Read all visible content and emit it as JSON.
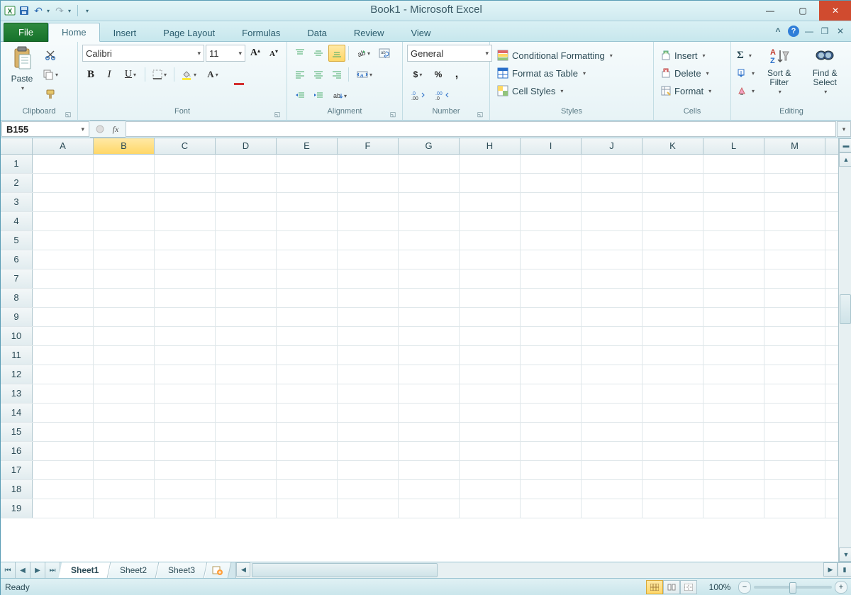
{
  "title": "Book1 - Microsoft Excel",
  "qat": {
    "undo": "↶",
    "redo": "↷"
  },
  "window_controls": {
    "min": "—",
    "max": "▢",
    "close": "✕"
  },
  "tabs": {
    "file": "File",
    "items": [
      "Home",
      "Insert",
      "Page Layout",
      "Formulas",
      "Data",
      "Review",
      "View"
    ],
    "active": "Home",
    "help": "?"
  },
  "mdi": {
    "min": "—",
    "restore": "❐",
    "close": "✕",
    "caret": "^"
  },
  "ribbon": {
    "clipboard": {
      "label": "Clipboard",
      "paste": "Paste"
    },
    "font": {
      "label": "Font",
      "name": "Calibri",
      "size": "11",
      "bold": "B",
      "italic": "I",
      "underline": "U"
    },
    "alignment": {
      "label": "Alignment"
    },
    "number": {
      "label": "Number",
      "format": "General",
      "currency": "$",
      "percent": "%",
      "comma": ",",
      "inc": ".0 .00",
      "dec": ".00 .0"
    },
    "styles": {
      "label": "Styles",
      "cond": "Conditional Formatting",
      "table": "Format as Table",
      "cell": "Cell Styles"
    },
    "cells": {
      "label": "Cells",
      "insert": "Insert",
      "delete": "Delete",
      "format": "Format"
    },
    "editing": {
      "label": "Editing",
      "sort": "Sort & Filter",
      "find": "Find & Select",
      "sum": "Σ"
    }
  },
  "formula_bar": {
    "name": "B155",
    "fx": "fx",
    "value": ""
  },
  "grid": {
    "cols": [
      "A",
      "B",
      "C",
      "D",
      "E",
      "F",
      "G",
      "H",
      "I",
      "J",
      "K",
      "L",
      "M"
    ],
    "rows": 19,
    "selected_col": "B"
  },
  "sheets": {
    "items": [
      "Sheet1",
      "Sheet2",
      "Sheet3"
    ],
    "active": "Sheet1"
  },
  "status": {
    "ready": "Ready",
    "zoom": "100%"
  }
}
